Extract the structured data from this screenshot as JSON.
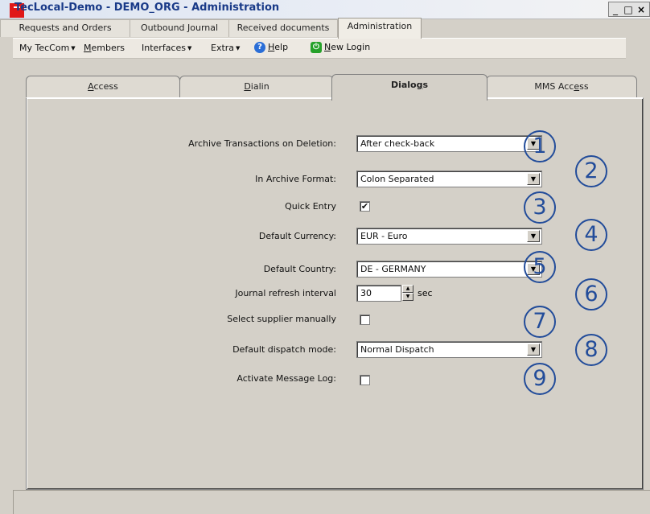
{
  "window": {
    "title": "TecLocal-Demo - DEMO_ORG - Administration",
    "controls": {
      "minimize": "_",
      "maximize": "□",
      "close": "×"
    }
  },
  "main_tabs": [
    {
      "label": "Requests and Orders",
      "active": false
    },
    {
      "label": "Outbound Journal",
      "active": false
    },
    {
      "label": "Received documents",
      "active": false
    },
    {
      "label": "Administration",
      "active": true
    }
  ],
  "menu": {
    "items": [
      {
        "label_pre": "My TecCom",
        "has_arrow": true
      },
      {
        "label_u": "M",
        "label_post": "embers"
      },
      {
        "label_pre": "Interfaces",
        "has_arrow": true
      },
      {
        "label_pre": "Extra",
        "has_arrow": true
      },
      {
        "icon": "help-icon",
        "label_u": "H",
        "label_post": "elp"
      },
      {
        "icon": "new-login-icon",
        "label_u": "N",
        "label_post": "ew Login"
      }
    ]
  },
  "sub_tabs": [
    {
      "label_u": "A",
      "label_post": "ccess",
      "active": false
    },
    {
      "label_u": "D",
      "label_post": "ialin",
      "active": false
    },
    {
      "label_pre": "Dialo",
      "label_u": "g",
      "label_post": "s",
      "active": true
    },
    {
      "label_pre": "MMS Acc",
      "label_u": "e",
      "label_post": "ss",
      "active": false
    }
  ],
  "settings": {
    "archive_on_deletion": {
      "label": "Archive Transactions on Deletion:",
      "value": "After check-back"
    },
    "archive_format": {
      "label": "In Archive Format:",
      "value": "Colon Separated"
    },
    "quick_entry": {
      "label": "Quick Entry",
      "checked": true,
      "mark": "✔"
    },
    "default_currency": {
      "label": "Default Currency:",
      "value": "EUR - Euro"
    },
    "default_country": {
      "label": "Default Country:",
      "value": "DE - GERMANY"
    },
    "journal_refresh": {
      "label": "Journal refresh interval",
      "value": "30",
      "unit": "sec"
    },
    "select_supplier": {
      "label": "Select supplier manually",
      "checked": false
    },
    "dispatch_mode": {
      "label": "Default dispatch mode:",
      "value": "Normal Dispatch"
    },
    "message_log": {
      "label": "Activate Message Log:",
      "checked": false
    }
  },
  "callouts": [
    "1",
    "2",
    "3",
    "4",
    "5",
    "6",
    "7",
    "8",
    "9"
  ],
  "colors": {
    "callout": "#224c9a",
    "title_text": "#193a88",
    "app_icon": "#e01818"
  }
}
